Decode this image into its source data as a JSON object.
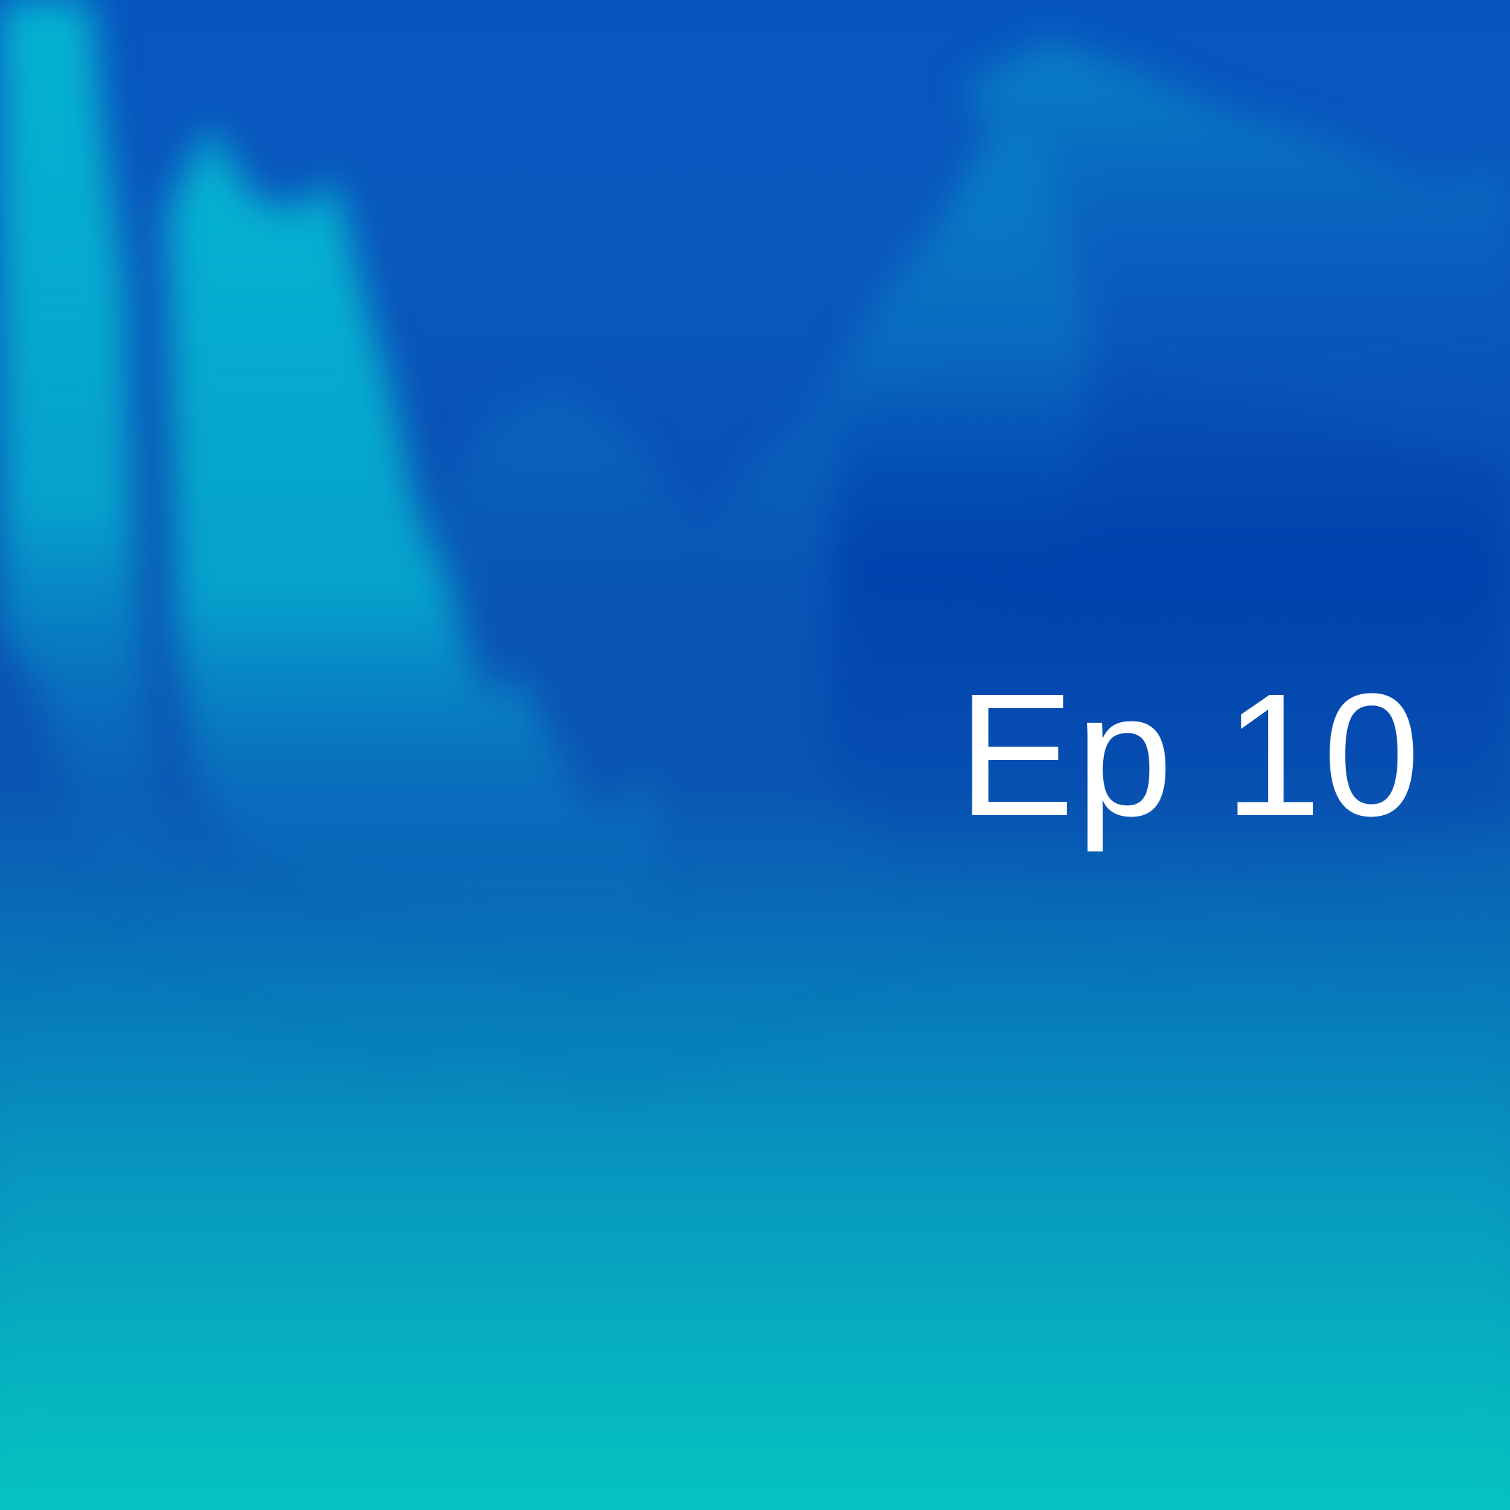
{
  "cover": {
    "episode_label": "Ep 10",
    "text_color": "#ffffff",
    "palette": {
      "deep_blue": "#0046ad",
      "mid_blue": "#0a66c2",
      "cyan": "#00bcd1",
      "teal": "#06c2bf"
    }
  }
}
